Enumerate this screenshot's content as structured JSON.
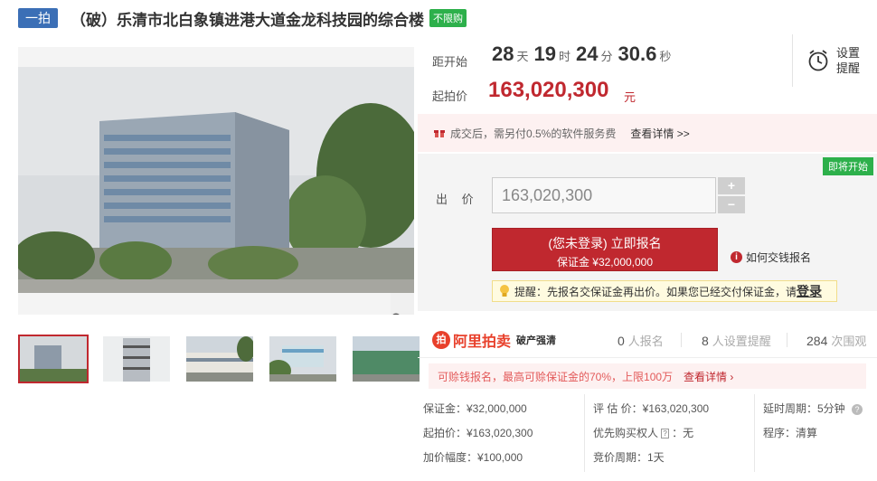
{
  "title": {
    "round": "一拍",
    "text": "（破）乐清市北白象镇进港大道金龙科技园的综合楼",
    "limit": "不限购"
  },
  "countdown": {
    "label": "距开始",
    "days": "28",
    "days_unit": "天",
    "hours": "19",
    "hours_unit": "时",
    "minutes": "24",
    "minutes_unit": "分",
    "seconds": "30.6",
    "seconds_unit": "秒"
  },
  "remind": {
    "label": "设置提醒"
  },
  "starting": {
    "label": "起拍价",
    "price": "163,020,300",
    "unit": "元"
  },
  "fee": {
    "text": "成交后，需另付0.5%的软件服务费",
    "link": "查看详情 >>"
  },
  "bid": {
    "status": "即将开始",
    "label": "出 价",
    "value": "163,020,300",
    "plus": "+",
    "minus": "−",
    "signup_main": "(您未登录) 立即报名",
    "signup_sub": "保证金 ¥32,000,000",
    "how_link": "如何交钱报名",
    "tip_prefix": "提醒：先报名交保证金再出价。如果您已经交付保证金，请",
    "tip_login": "登录"
  },
  "platform": {
    "name": "阿里拍卖",
    "sub": "破产强清"
  },
  "stats": [
    {
      "num": "0",
      "label": "人报名"
    },
    {
      "num": "8",
      "label": "人设置提醒"
    },
    {
      "num": "284",
      "label": "次围观"
    }
  ],
  "pay": {
    "text": "可赊钱报名，最高可赊保证金的70%，上限100万",
    "link": "查看详情"
  },
  "info": {
    "deposit": "保证金：¥32,000,000",
    "start_price": "起拍价：¥163,020,300",
    "increment": "加价幅度：¥100,000",
    "appraisal": "评 估 价：¥163,020,300",
    "priority_label": "优先购买权人",
    "priority_value": "：无",
    "period": "竞价周期：1天",
    "delay": "延时周期：5分钟",
    "procedure": "程序：清算"
  },
  "colors": {
    "accent": "#c0282f",
    "green": "#2db04b",
    "blue": "#3b6fb6"
  }
}
